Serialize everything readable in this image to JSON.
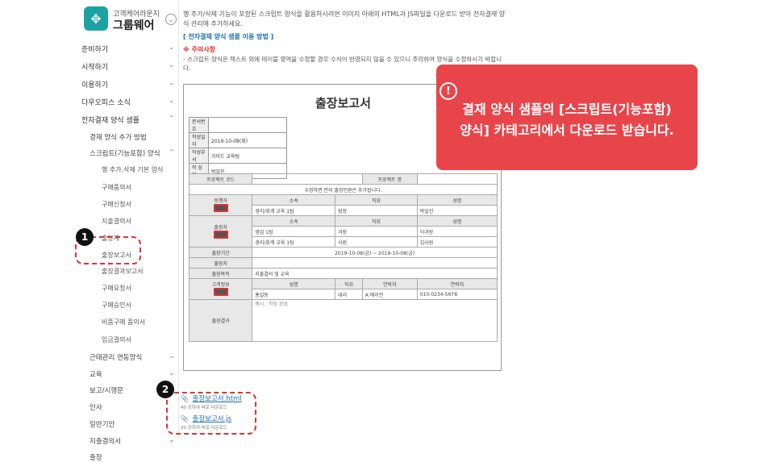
{
  "sidebar": {
    "logo_glyph": "✥",
    "logo_subtitle": "고객케어라운지",
    "logo_title": "그룹웨어",
    "items": [
      {
        "label": "준비하기",
        "chev": "⌄"
      },
      {
        "label": "시작하기",
        "chev": "⌄"
      },
      {
        "label": "이용하기",
        "chev": "⌄"
      },
      {
        "label": "다우오피스 소식",
        "chev": "⌄"
      },
      {
        "label": "전자결재 양식 샘플",
        "chev": "⌃"
      },
      {
        "label": "결재 양식 추가 방법"
      },
      {
        "label": "스크립트(기능포함) 양식",
        "chev": "⌃"
      },
      {
        "label": "행 추가,삭제 기본 양식"
      },
      {
        "label": "구매품의서"
      },
      {
        "label": "구매신청서"
      },
      {
        "label": "지출결의서"
      },
      {
        "label": "출장계"
      },
      {
        "label": "출장보고서"
      },
      {
        "label": "출장결과보고서"
      },
      {
        "label": "구매요청서"
      },
      {
        "label": "구매승인서"
      },
      {
        "label": "비품구매 품의서"
      },
      {
        "label": "입금결의서"
      },
      {
        "label": "근태관리 연동양식",
        "chev": "⌄"
      },
      {
        "label": "교육",
        "chev": "⌄"
      },
      {
        "label": "보고/시행문",
        "chev": "⌄"
      },
      {
        "label": "인사"
      },
      {
        "label": "일반기안"
      },
      {
        "label": "지출결의서",
        "chev": "⌄"
      },
      {
        "label": "출장"
      }
    ]
  },
  "main": {
    "intro": "행 추가/삭제 기능이 포함된 스크립트 양식을 활용하시려면 이미지 아래의 HTML과 JS파일을 다운로드 받아 전자결재 양식 관리에 추가하세요.",
    "howto_link": "[ 전자결재 양식 샘플 이용 방법 ]",
    "caution_title": "※ 주의사항",
    "caution_text": "- 스크립트 양식은 텍스트 외에 테이블 영역을 수정할 경우 수식이 반영되지 않을 수 있으니 주의하여 양식을 수정하시기 바랍니다."
  },
  "document": {
    "title": "출장보고서",
    "info": [
      {
        "k": "문서번호",
        "v": ""
      },
      {
        "k": "작성일자",
        "v": "2019-10-08(화)"
      },
      {
        "k": "작성부서",
        "v": "가이드 교육팀"
      },
      {
        "k": "작 성 자",
        "v": "박일진"
      }
    ],
    "project_code_label": "프로젝트 코드",
    "project_name_label": "프로젝트 명",
    "note": "수정하면 안의 출장인원은 추가됩니다.",
    "header_affil": "소속",
    "header_title": "직위",
    "header_name": "성명",
    "companions_label": "동행자",
    "companions": [
      {
        "affil": "경리/회계 교육 1팀",
        "title": "팀장",
        "name": "박일진"
      }
    ],
    "travelers_label": "출장자",
    "travelers": [
      {
        "affil": "영업 1팀",
        "title": "과장",
        "name": "이과장"
      },
      {
        "affil": "경리/회계 교육 1팀",
        "title": "사원",
        "name": "김사원"
      }
    ],
    "period_label": "출장기간",
    "period_from": "2019-10-08(금)",
    "period_sep": "~",
    "period_to": "2019-10-08(금)",
    "place_label": "출장지",
    "purpose_label": "출장목적",
    "purpose": "지출결의 및 교육",
    "clients_label": "고객정보",
    "clients_headers": [
      "성명",
      "직위",
      "연락처",
      "연락처"
    ],
    "client": {
      "name": "홍길동",
      "title": "대리",
      "company": "A 에이전",
      "phone": "010-0234-5678"
    },
    "result_label": "출장결과",
    "result_placeholder": "예시 : 작성 완료"
  },
  "files": [
    {
      "name": "출장보고서.html",
      "meta": "40 강하여 바로 다운로드"
    },
    {
      "name": "출장보고서.js",
      "meta": "30 강하여 바로 다운로드"
    }
  ],
  "callout": {
    "icon": "!",
    "line1": "결재 양식 샘플의 [스크립트(기능포함)",
    "line2": "양식] 카테고리에서 다운로드 받습니다."
  },
  "badges": {
    "one": "1",
    "two": "2"
  }
}
